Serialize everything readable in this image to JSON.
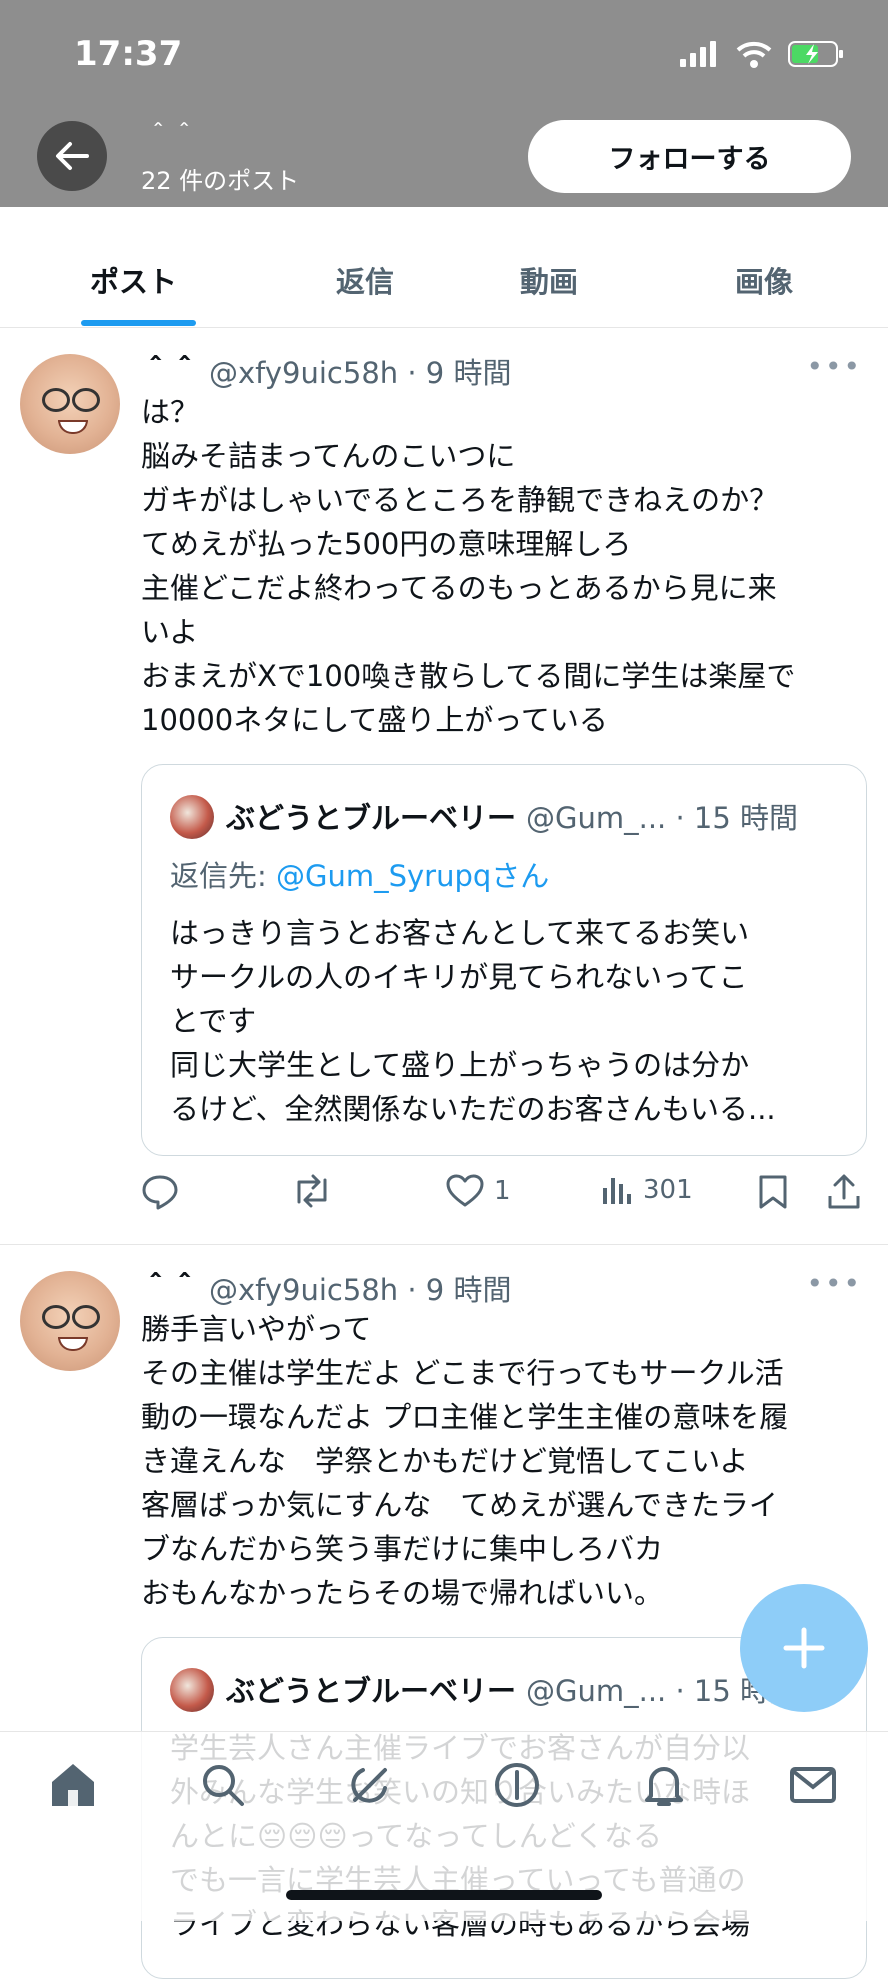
{
  "status_bar": {
    "time": "17:37"
  },
  "header": {
    "profile_name": "＾＾",
    "post_count": "22 件のポスト",
    "follow_label": "フォローする"
  },
  "tabs": [
    {
      "label": "ポスト",
      "active": true
    },
    {
      "label": "返信",
      "active": false
    },
    {
      "label": "動画",
      "active": false
    },
    {
      "label": "画像",
      "active": false
    }
  ],
  "posts": [
    {
      "name": "＾＾",
      "handle": "@xfy9uic58h",
      "time": "· 9 時間",
      "body": "は？\n脳みそ詰まってんのこいつに\nガキがはしゃいでるところを静観できねえのか？\nてめえが払った500円の意味理解しろ\n主催どこだよ終わってるのもっとあるから見に来\nいよ\nおまえがXで100喚き散らしてる間に学生は楽屋で\n10000ネタにして盛り上がっている",
      "quote": {
        "name": "ぶどうとブルーベリー",
        "handle": "@Gum_...",
        "time": "· 15 時間",
        "reply_prefix": "返信先:",
        "reply_to": "@Gum_Syrupqさん",
        "text": "はっきり言うとお客さんとして来てるお笑い\nサークルの人のイキリが見てられないってこ\nとです\n同じ大学生として盛り上がっちゃうのは分か\nるけど、全然関係ないただのお客さんもいる..."
      },
      "likes": "1",
      "views": "301"
    },
    {
      "name": "＾＾",
      "handle": "@xfy9uic58h",
      "time": "· 9 時間",
      "body": "勝手言いやがって\nその主催は学生だよ どこまで行ってもサークル活\n動の一環なんだよ プロ主催と学生主催の意味を履\nき違えんな　学祭とかもだけど覚悟してこいよ\n客層ばっか気にすんな　てめえが選んできたライ\nブなんだから笑う事だけに集中しろバカ\nおもんなかったらその場で帰ればいい。",
      "quote": {
        "name": "ぶどうとブルーベリー",
        "handle": "@Gum_...",
        "time": "· 15 時間",
        "text": "学生芸人さん主催ライブでお客さんが自分以\n外みんな学生お笑いの知り合いみたいな時ほ\nんとに😔😔😔ってなってしんどくなる\nでも一言に学生芸人主催っていっても普通の\nライブと変わらない客層の時もあるから会場"
      }
    }
  ],
  "colors": {
    "accent": "#1d9bf0",
    "header_bg": "#8e8e8e",
    "fab": "#8ecdf8",
    "text_secondary": "#536471"
  },
  "icons": {
    "back": "arrow-left-icon",
    "more": "more-icon",
    "reply": "reply-icon",
    "repost": "repost-icon",
    "like": "heart-icon",
    "views": "views-icon",
    "bookmark": "bookmark-icon",
    "share": "share-icon",
    "compose": "plus-icon",
    "nav": [
      "home-icon",
      "search-icon",
      "grok-icon",
      "communities-icon",
      "notifications-icon",
      "messages-icon"
    ]
  }
}
